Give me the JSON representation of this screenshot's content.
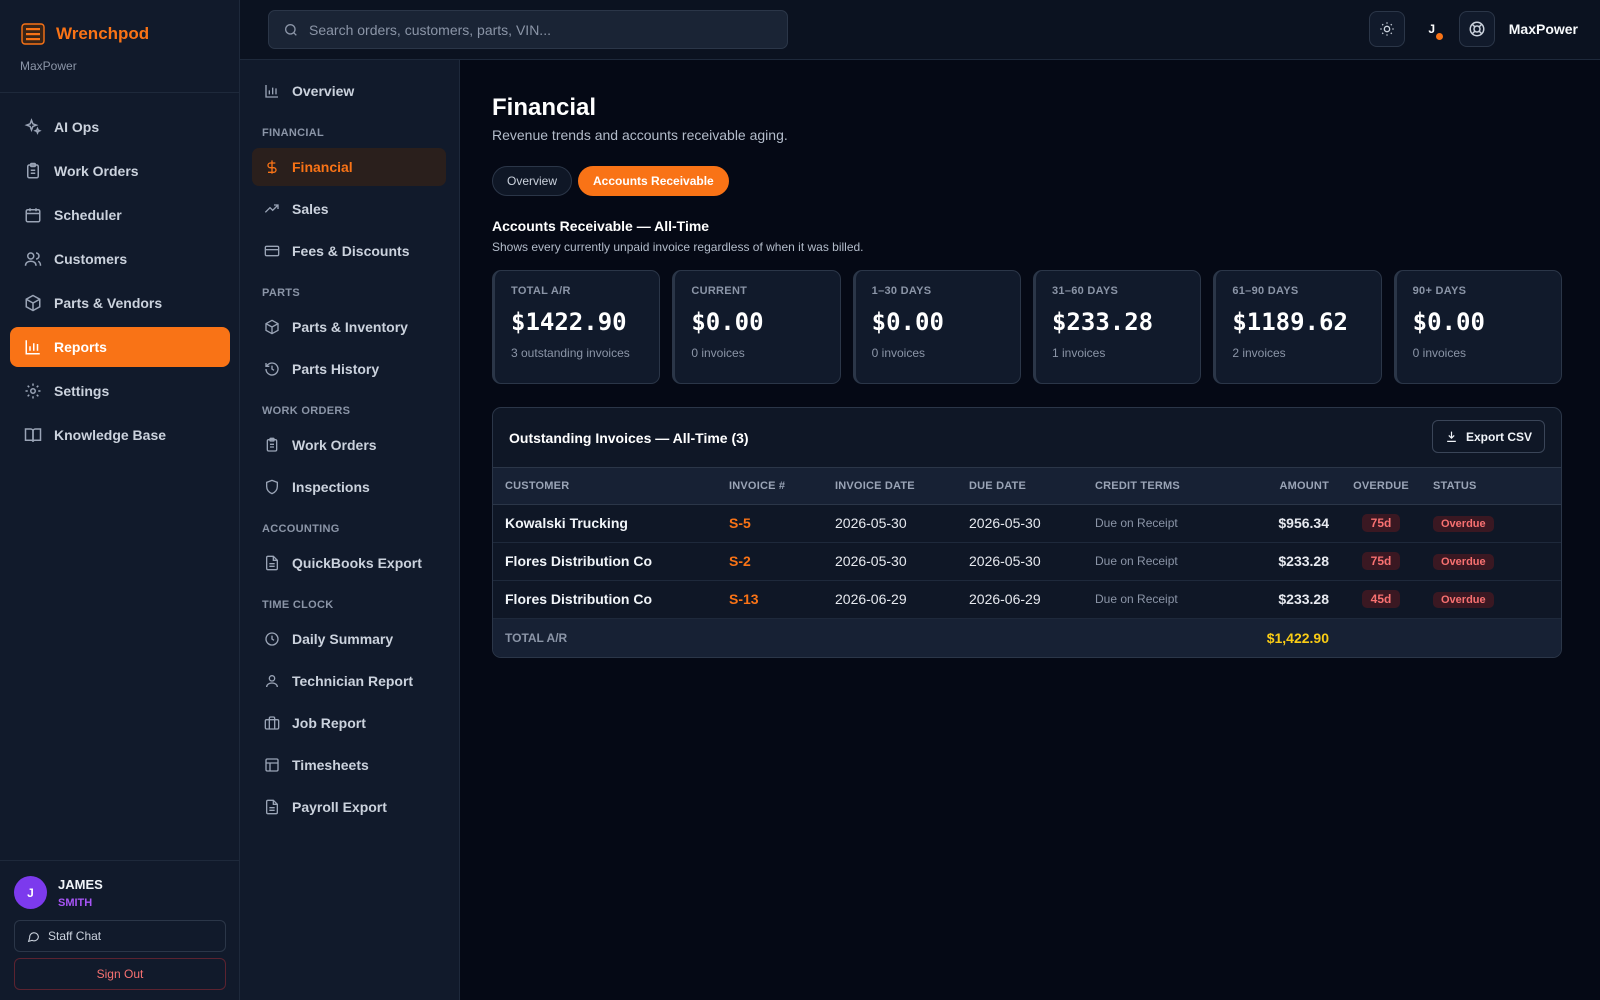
{
  "brand": {
    "name": "Wrenchpod",
    "sub": "MaxPower"
  },
  "nav": [
    {
      "label": "AI Ops",
      "icon": "sparkles-icon"
    },
    {
      "label": "Work Orders",
      "icon": "clipboard-icon"
    },
    {
      "label": "Scheduler",
      "icon": "calendar-icon"
    },
    {
      "label": "Customers",
      "icon": "users-icon"
    },
    {
      "label": "Parts & Vendors",
      "icon": "package-icon"
    },
    {
      "label": "Reports",
      "icon": "bar-chart-icon",
      "active": true
    },
    {
      "label": "Settings",
      "icon": "gear-icon"
    },
    {
      "label": "Knowledge Base",
      "icon": "book-icon"
    }
  ],
  "user": {
    "initial": "J",
    "first": "JAMES",
    "last": "SMITH",
    "chat_label": "Staff Chat",
    "signout_label": "Sign Out"
  },
  "search": {
    "placeholder": "Search orders, customers, parts, VIN..."
  },
  "topbar": {
    "user_initial": "J",
    "org_name": "MaxPower"
  },
  "subnav": {
    "overview": "Overview",
    "groups": [
      {
        "heading": "FINANCIAL",
        "items": [
          "Financial",
          "Sales",
          "Fees & Discounts"
        ]
      },
      {
        "heading": "PARTS",
        "items": [
          "Parts & Inventory",
          "Parts History"
        ]
      },
      {
        "heading": "WORK ORDERS",
        "items": [
          "Work Orders",
          "Inspections"
        ]
      },
      {
        "heading": "ACCOUNTING",
        "items": [
          "QuickBooks Export"
        ]
      },
      {
        "heading": "TIME CLOCK",
        "items": [
          "Daily Summary",
          "Technician Report",
          "Job Report",
          "Timesheets",
          "Payroll Export"
        ]
      }
    ]
  },
  "page": {
    "title": "Financial",
    "subtitle": "Revenue trends and accounts receivable aging.",
    "tabs": [
      "Overview",
      "Accounts Receivable"
    ],
    "active_tab": "Accounts Receivable",
    "section_title": "Accounts Receivable — All-Time",
    "section_sub": "Shows every currently unpaid invoice regardless of when it was billed."
  },
  "cards": [
    {
      "label": "TOTAL A/R",
      "value": "$1422.90",
      "note": "3 outstanding invoices"
    },
    {
      "label": "CURRENT",
      "value": "$0.00",
      "note": "0 invoices"
    },
    {
      "label": "1–30 DAYS",
      "value": "$0.00",
      "note": "0 invoices"
    },
    {
      "label": "31–60 DAYS",
      "value": "$233.28",
      "note": "1 invoices"
    },
    {
      "label": "61–90 DAYS",
      "value": "$1189.62",
      "note": "2 invoices"
    },
    {
      "label": "90+ DAYS",
      "value": "$0.00",
      "note": "0 invoices"
    }
  ],
  "table": {
    "title": "Outstanding Invoices — All-Time (3)",
    "export_label": "Export CSV",
    "headers": {
      "customer": "CUSTOMER",
      "invoice": "INVOICE #",
      "invoice_date": "INVOICE DATE",
      "due_date": "DUE DATE",
      "terms": "CREDIT TERMS",
      "amount": "AMOUNT",
      "overdue": "OVERDUE",
      "status": "STATUS"
    },
    "rows": [
      {
        "customer": "Kowalski Trucking",
        "invoice": "S-5",
        "invoice_date": "2026-05-30",
        "due_date": "2026-05-30",
        "terms": "Due on Receipt",
        "amount": "$956.34",
        "overdue": "75d",
        "status": "Overdue"
      },
      {
        "customer": "Flores Distribution Co",
        "invoice": "S-2",
        "invoice_date": "2026-05-30",
        "due_date": "2026-05-30",
        "terms": "Due on Receipt",
        "amount": "$233.28",
        "overdue": "75d",
        "status": "Overdue"
      },
      {
        "customer": "Flores Distribution Co",
        "invoice": "S-13",
        "invoice_date": "2026-06-29",
        "due_date": "2026-06-29",
        "terms": "Due on Receipt",
        "amount": "$233.28",
        "overdue": "45d",
        "status": "Overdue"
      }
    ],
    "total_label": "TOTAL A/R",
    "total_value": "$1,422.90"
  },
  "colors": {
    "accent": "#f97316",
    "background": "#050915",
    "panel": "#111a2b",
    "total": "#facc15",
    "danger": "#f87171"
  }
}
